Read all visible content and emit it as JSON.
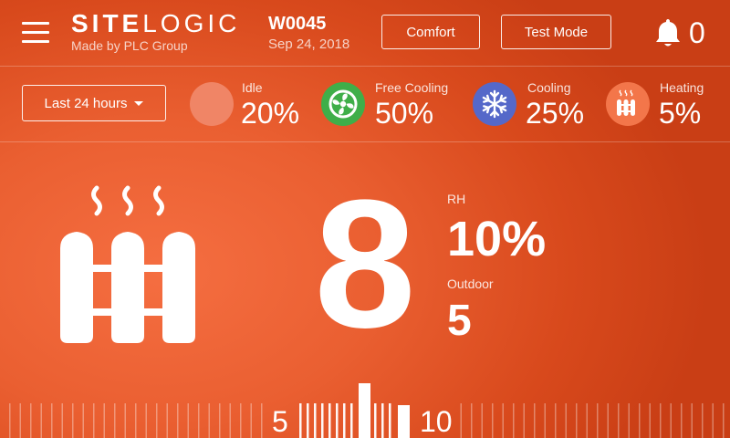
{
  "header": {
    "brand_bold": "SITE",
    "brand_light": "LOGIC",
    "brand_tagline": "Made by PLC Group",
    "device_id": "W0045",
    "device_date": "Sep 24, 2018",
    "comfort_label": "Comfort",
    "test_mode_label": "Test Mode",
    "alert_count": "0"
  },
  "status": {
    "range_label": "Last 24 hours",
    "modes": [
      {
        "label": "Idle",
        "value": "20%",
        "icon": "idle-circle-icon",
        "color": "#f08566"
      },
      {
        "label": "Free Cooling",
        "value": "50%",
        "icon": "fan-icon",
        "color": "#3fae49"
      },
      {
        "label": "Cooling",
        "value": "25%",
        "icon": "snowflake-icon",
        "color": "#5568c9"
      },
      {
        "label": "Heating",
        "value": "5%",
        "icon": "radiator-icon",
        "color": "#f3764a"
      }
    ]
  },
  "main": {
    "setpoint": "8",
    "rh_label": "RH",
    "rh_value": "10%",
    "outdoor_label": "Outdoor",
    "outdoor_value": "5"
  },
  "ruler": {
    "min_label": "5",
    "max_label": "10"
  },
  "colors": {
    "background": "#e85a2c",
    "accent_white": "#ffffff"
  }
}
